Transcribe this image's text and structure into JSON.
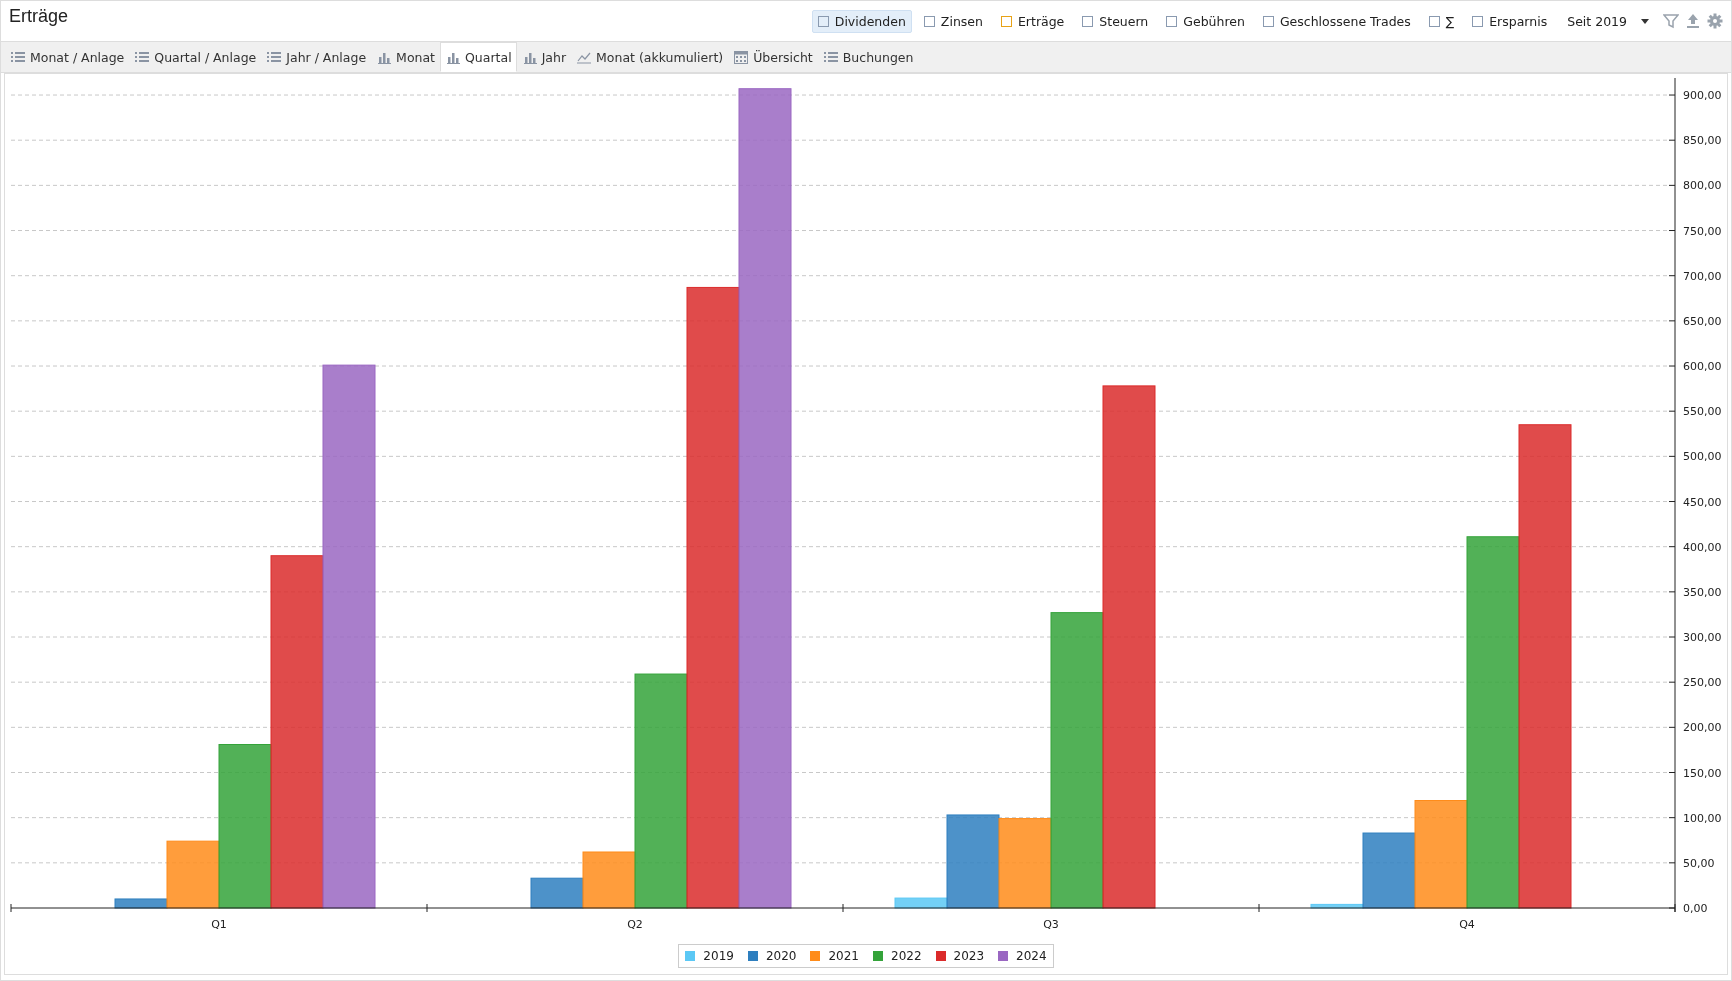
{
  "window": {
    "title": "Erträge"
  },
  "toolbar": {
    "toggles": [
      {
        "label": "Dividenden",
        "selected": true,
        "color": "#8a9ab0"
      },
      {
        "label": "Zinsen",
        "selected": false,
        "color": "#8a9ab0"
      },
      {
        "label": "Erträge",
        "selected": false,
        "color": "#e8a317"
      },
      {
        "label": "Steuern",
        "selected": false,
        "color": "#8a9ab0"
      },
      {
        "label": "Gebühren",
        "selected": false,
        "color": "#8a9ab0"
      },
      {
        "label": "Geschlossene Trades",
        "selected": false,
        "color": "#8a9ab0"
      },
      {
        "label": "∑",
        "selected": false,
        "color": "#8a9ab0"
      },
      {
        "label": "Ersparnis",
        "selected": false,
        "color": "#8a9ab0"
      }
    ],
    "period": "Seit 2019"
  },
  "tabs": [
    {
      "label": "Monat / Anlage",
      "kind": "list",
      "selected": false
    },
    {
      "label": "Quartal / Anlage",
      "kind": "list",
      "selected": false
    },
    {
      "label": "Jahr / Anlage",
      "kind": "list",
      "selected": false
    },
    {
      "label": "Monat",
      "kind": "bar",
      "selected": false
    },
    {
      "label": "Quartal",
      "kind": "bar",
      "selected": true
    },
    {
      "label": "Jahr",
      "kind": "bar",
      "selected": false
    },
    {
      "label": "Monat (akkumuliert)",
      "kind": "line",
      "selected": false
    },
    {
      "label": "Übersicht",
      "kind": "calendar",
      "selected": false
    },
    {
      "label": "Buchungen",
      "kind": "list",
      "selected": false
    }
  ],
  "chart": {
    "chart_data": {
      "type": "bar",
      "categories": [
        "Q1",
        "Q2",
        "Q3",
        "Q4"
      ],
      "series": [
        {
          "name": "2019",
          "color": "#5bc8f5",
          "values": [
            null,
            null,
            11,
            4
          ]
        },
        {
          "name": "2020",
          "color": "#2e7fbf",
          "values": [
            10,
            33,
            103,
            83
          ]
        },
        {
          "name": "2021",
          "color": "#ff8c1a",
          "values": [
            74,
            62,
            99,
            119
          ]
        },
        {
          "name": "2022",
          "color": "#34a33a",
          "values": [
            181,
            259,
            327,
            411
          ]
        },
        {
          "name": "2023",
          "color": "#db2b2b",
          "values": [
            390,
            687,
            578,
            535
          ]
        },
        {
          "name": "2024",
          "color": "#9a67c2",
          "values": [
            601,
            907,
            null,
            null
          ]
        }
      ],
      "ylim": [
        0,
        910
      ],
      "grid": true,
      "legend": true,
      "yticks": [
        {
          "value": 0,
          "label": "0,00"
        },
        {
          "value": 50,
          "label": "50,00"
        },
        {
          "value": 100,
          "label": "100,00"
        },
        {
          "value": 150,
          "label": "150,00"
        },
        {
          "value": 200,
          "label": "200,00"
        },
        {
          "value": 250,
          "label": "250,00"
        },
        {
          "value": 300,
          "label": "300,00"
        },
        {
          "value": 350,
          "label": "350,00"
        },
        {
          "value": 400,
          "label": "400,00"
        },
        {
          "value": 450,
          "label": "450,00"
        },
        {
          "value": 500,
          "label": "500,00"
        },
        {
          "value": 550,
          "label": "550,00"
        },
        {
          "value": 600,
          "label": "600,00"
        },
        {
          "value": 650,
          "label": "650,00"
        },
        {
          "value": 700,
          "label": "700,00"
        },
        {
          "value": 750,
          "label": "750,00"
        },
        {
          "value": 800,
          "label": "800,00"
        },
        {
          "value": 850,
          "label": "850,00"
        },
        {
          "value": 900,
          "label": "900,00"
        }
      ]
    }
  }
}
